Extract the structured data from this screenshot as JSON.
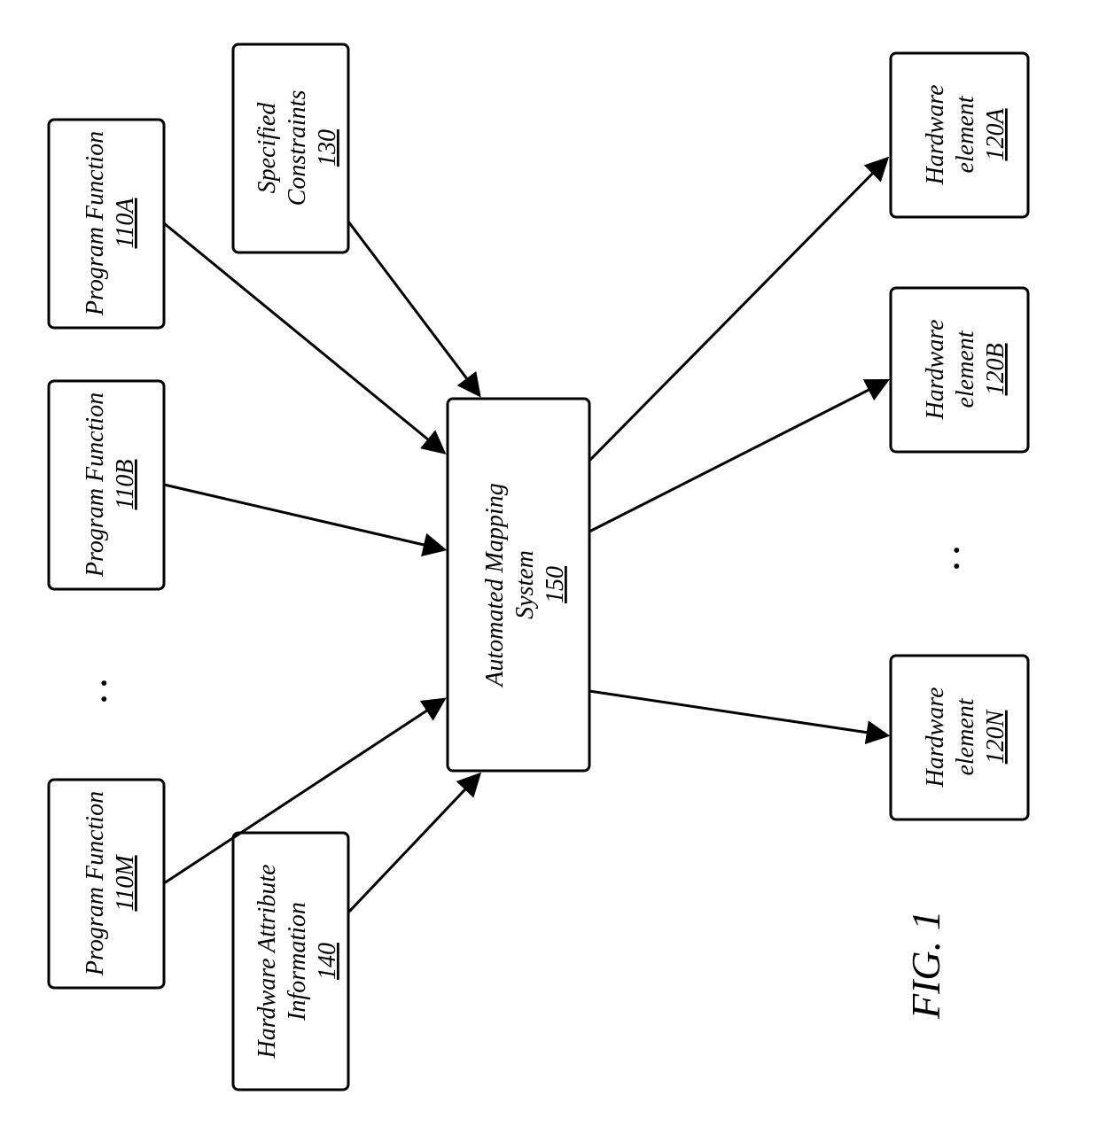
{
  "figure_label": "FIG. 1",
  "inputs": {
    "program_functions": [
      {
        "title": "Program Function",
        "id": "110A"
      },
      {
        "title": "Program Function",
        "id": "110B"
      },
      {
        "title": "Program Function",
        "id": "110M"
      }
    ],
    "specified_constraints": {
      "title_l1": "Specified",
      "title_l2": "Constraints",
      "id": "130"
    },
    "hardware_attribute": {
      "title_l1": "Hardware Attribute",
      "title_l2": "Information",
      "id": "140"
    }
  },
  "center": {
    "title_l1": "Automated Mapping",
    "title_l2": "System",
    "id": "150"
  },
  "outputs": {
    "hardware_elements": [
      {
        "title_l1": "Hardware",
        "title_l2": "element",
        "id": "120A"
      },
      {
        "title_l1": "Hardware",
        "title_l2": "element",
        "id": "120B"
      },
      {
        "title_l1": "Hardware",
        "title_l2": "element",
        "id": "120N"
      }
    ]
  },
  "ellipses": {
    "pf": ". .",
    "he": ". ."
  }
}
